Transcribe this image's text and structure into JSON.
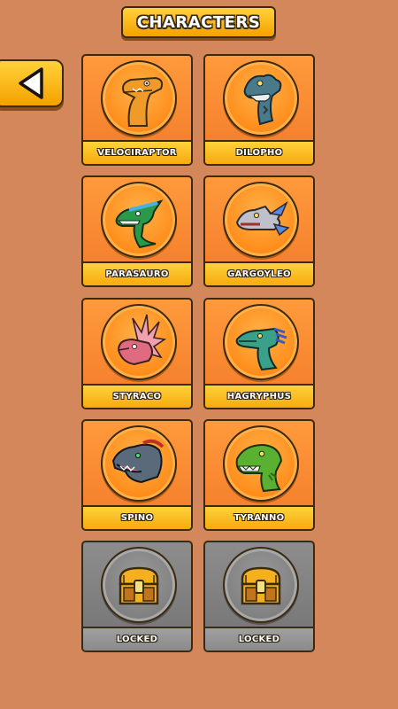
{
  "header": {
    "title": "CHARACTERS"
  },
  "back_button": {
    "icon": "back-arrow-icon"
  },
  "characters": [
    {
      "name": "VELOCIRAPTOR",
      "locked": false,
      "icon": "velociraptor-icon",
      "color": "#f0a02a"
    },
    {
      "name": "DILOPHO",
      "locked": false,
      "icon": "dilopho-icon",
      "color": "#4a7a8a"
    },
    {
      "name": "PARASAURO",
      "locked": false,
      "icon": "parasauro-icon",
      "color": "#2a9a4a"
    },
    {
      "name": "GARGOYLEO",
      "locked": false,
      "icon": "gargoyleo-icon",
      "color": "#b0b0c0"
    },
    {
      "name": "STYRACO",
      "locked": false,
      "icon": "styraco-icon",
      "color": "#e07080"
    },
    {
      "name": "HAGRYPHUS",
      "locked": false,
      "icon": "hagryphus-icon",
      "color": "#3aa08a"
    },
    {
      "name": "SPINO",
      "locked": false,
      "icon": "spino-icon",
      "color": "#5a6a7a"
    },
    {
      "name": "TYRANNO",
      "locked": false,
      "icon": "tyranno-icon",
      "color": "#5ab030"
    },
    {
      "name": "LOCKED",
      "locked": true,
      "icon": "treasure-chest-icon",
      "color": "#f5b020"
    },
    {
      "name": "LOCKED",
      "locked": true,
      "icon": "treasure-chest-icon",
      "color": "#f5b020"
    }
  ]
}
